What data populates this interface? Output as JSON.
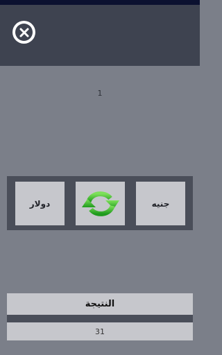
{
  "header": {
    "close_icon": "close-icon"
  },
  "input": {
    "value": "1"
  },
  "converter": {
    "from_currency": "دولار",
    "to_currency": "جنيه",
    "swap_icon": "refresh-arrows-icon",
    "swap_icon_color": "#2fb52a"
  },
  "result": {
    "label": "النتيجة",
    "value": "31"
  }
}
